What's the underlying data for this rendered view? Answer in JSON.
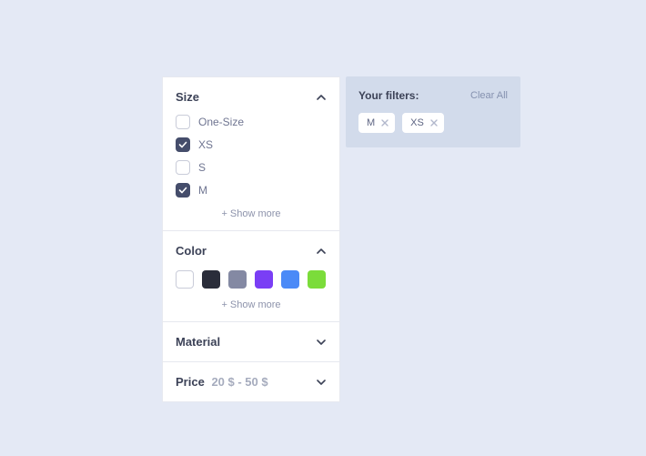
{
  "filters_applied": {
    "title": "Your filters:",
    "clear_all": "Clear All",
    "chips": [
      "M",
      "XS"
    ]
  },
  "sections": {
    "size": {
      "title": "Size",
      "options": [
        {
          "label": "One-Size",
          "checked": false
        },
        {
          "label": "XS",
          "checked": true
        },
        {
          "label": "S",
          "checked": false
        },
        {
          "label": "M",
          "checked": true
        }
      ],
      "show_more": "+ Show more"
    },
    "color": {
      "title": "Color",
      "swatches": [
        "#ffffff",
        "#2a2d3a",
        "#8489a3",
        "#7a3ef5",
        "#4b8af7",
        "#7bdc3a"
      ],
      "show_more": "+ Show more"
    },
    "material": {
      "title": "Material"
    },
    "price": {
      "title": "Price",
      "range": "20 $ - 50 $"
    }
  }
}
